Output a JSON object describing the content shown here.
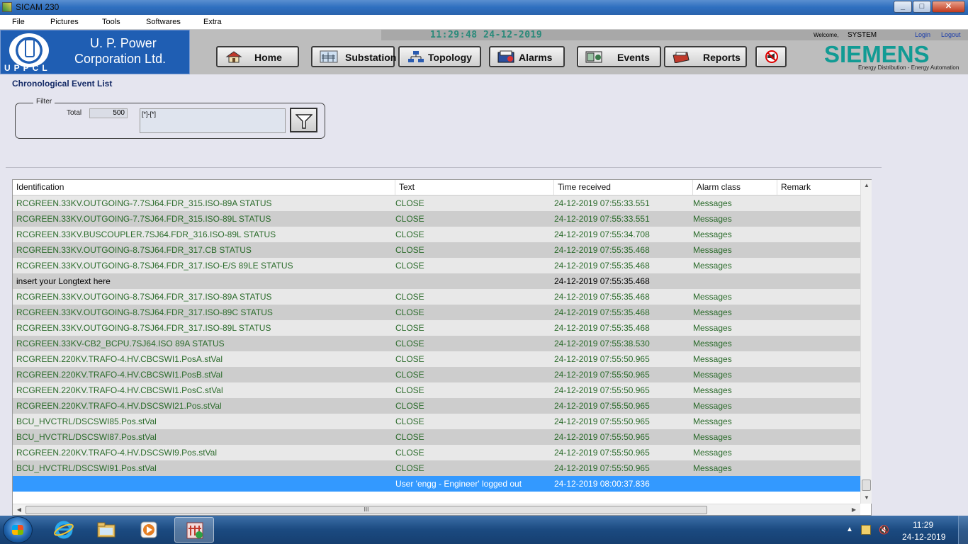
{
  "window": {
    "title": "SICAM 230"
  },
  "menu": [
    "File",
    "Pictures",
    "Tools",
    "Softwares",
    "Extra"
  ],
  "header": {
    "org_line1": "U. P. Power",
    "org_line2": "Corporation Ltd.",
    "org_abbr": "UPPCL",
    "clock": "11:29:48  24-12-2019",
    "welcome": "Welcome,",
    "user": "SYSTEM",
    "login": "Login",
    "logout": "Logout",
    "brand": "SIEMENS",
    "brand_sub": "Energy Distribution - Energy Automation"
  },
  "nav": {
    "home": "Home",
    "substation": "Substation",
    "topology": "Topology",
    "alarms": "Alarms",
    "events": "Events",
    "reports": "Reports"
  },
  "page": {
    "heading": "Chronological Event List",
    "filter_legend": "Filter",
    "total_label": "Total",
    "total_value": "500",
    "filter_expression": "[*]-[*]"
  },
  "table": {
    "columns": [
      "Identification",
      "Text",
      "Time received",
      "Alarm class",
      "Remark"
    ],
    "rows": [
      {
        "id": "RCGREEN.33KV.OUTGOING-7.7SJ64.FDR_315.ISO-89A STATUS",
        "text": "CLOSE",
        "time": "24-12-2019 07:55:33.551",
        "cls": "Messages",
        "remark": ""
      },
      {
        "id": "RCGREEN.33KV.OUTGOING-7.7SJ64.FDR_315.ISO-89L STATUS",
        "text": "CLOSE",
        "time": "24-12-2019 07:55:33.551",
        "cls": "Messages",
        "remark": ""
      },
      {
        "id": "RCGREEN.33KV.BUSCOUPLER.7SJ64.FDR_316.ISO-89L STATUS",
        "text": "CLOSE",
        "time": "24-12-2019 07:55:34.708",
        "cls": "Messages",
        "remark": ""
      },
      {
        "id": "RCGREEN.33KV.OUTGOING-8.7SJ64.FDR_317.CB STATUS",
        "text": "CLOSE",
        "time": "24-12-2019 07:55:35.468",
        "cls": "Messages",
        "remark": ""
      },
      {
        "id": "RCGREEN.33KV.OUTGOING-8.7SJ64.FDR_317.ISO-E/S 89LE STATUS",
        "text": "CLOSE",
        "time": "24-12-2019 07:55:35.468",
        "cls": "Messages",
        "remark": ""
      },
      {
        "id": "insert your Longtext here",
        "text": "",
        "time": "24-12-2019 07:55:35.468",
        "cls": "",
        "remark": "",
        "plain": true
      },
      {
        "id": "RCGREEN.33KV.OUTGOING-8.7SJ64.FDR_317.ISO-89A STATUS",
        "text": "CLOSE",
        "time": "24-12-2019 07:55:35.468",
        "cls": "Messages",
        "remark": ""
      },
      {
        "id": "RCGREEN.33KV.OUTGOING-8.7SJ64.FDR_317.ISO-89C STATUS",
        "text": "CLOSE",
        "time": "24-12-2019 07:55:35.468",
        "cls": "Messages",
        "remark": ""
      },
      {
        "id": "RCGREEN.33KV.OUTGOING-8.7SJ64.FDR_317.ISO-89L STATUS",
        "text": "CLOSE",
        "time": "24-12-2019 07:55:35.468",
        "cls": "Messages",
        "remark": ""
      },
      {
        "id": "RCGREEN.33KV-CB2_BCPU.7SJ64.ISO 89A STATUS",
        "text": "CLOSE",
        "time": "24-12-2019 07:55:38.530",
        "cls": "Messages",
        "remark": ""
      },
      {
        "id": "RCGREEN.220KV.TRAFO-4.HV.CBCSWI1.PosA.stVal",
        "text": "CLOSE",
        "time": "24-12-2019 07:55:50.965",
        "cls": "Messages",
        "remark": ""
      },
      {
        "id": "RCGREEN.220KV.TRAFO-4.HV.CBCSWI1.PosB.stVal",
        "text": "CLOSE",
        "time": "24-12-2019 07:55:50.965",
        "cls": "Messages",
        "remark": ""
      },
      {
        "id": "RCGREEN.220KV.TRAFO-4.HV.CBCSWI1.PosC.stVal",
        "text": "CLOSE",
        "time": "24-12-2019 07:55:50.965",
        "cls": "Messages",
        "remark": ""
      },
      {
        "id": "RCGREEN.220KV.TRAFO-4.HV.DSCSWI21.Pos.stVal",
        "text": "CLOSE",
        "time": "24-12-2019 07:55:50.965",
        "cls": "Messages",
        "remark": ""
      },
      {
        "id": "BCU_HVCTRL/DSCSWI85.Pos.stVal",
        "text": "CLOSE",
        "time": "24-12-2019 07:55:50.965",
        "cls": "Messages",
        "remark": ""
      },
      {
        "id": "BCU_HVCTRL/DSCSWI87.Pos.stVal",
        "text": "CLOSE",
        "time": "24-12-2019 07:55:50.965",
        "cls": "Messages",
        "remark": ""
      },
      {
        "id": "RCGREEN.220KV.TRAFO-4.HV.DSCSWI9.Pos.stVal",
        "text": "CLOSE",
        "time": "24-12-2019 07:55:50.965",
        "cls": "Messages",
        "remark": ""
      },
      {
        "id": "BCU_HVCTRL/DSCSWI91.Pos.stVal",
        "text": "CLOSE",
        "time": "24-12-2019 07:55:50.965",
        "cls": "Messages",
        "remark": ""
      },
      {
        "id": "",
        "text": "User 'engg - Engineer' logged out",
        "time": "24-12-2019 08:00:37.836",
        "cls": "",
        "remark": "",
        "selected": true
      }
    ],
    "hscroll_grip": "III"
  },
  "taskbar": {
    "time": "11:29",
    "date": "24-12-2019",
    "apps": [
      "internet-explorer",
      "file-explorer",
      "media-player",
      "sicam-230"
    ]
  },
  "colors": {
    "row_text": "#2b6b2b",
    "selected_row": "#3399ff",
    "brand": "#129b94",
    "logo_bg": "#1f5eb3"
  }
}
